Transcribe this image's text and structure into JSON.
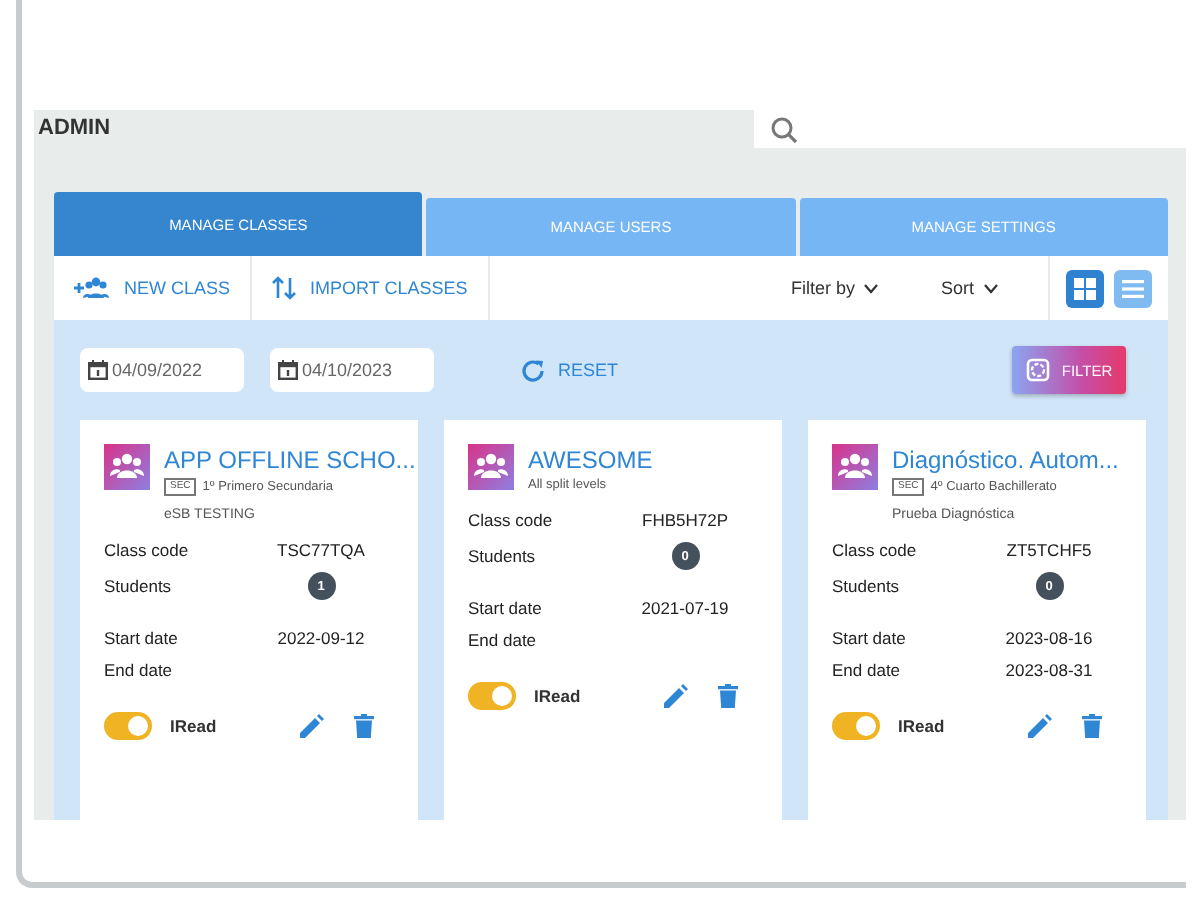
{
  "header": {
    "title": "ADMIN"
  },
  "tabs": [
    {
      "label": "MANAGE CLASSES",
      "selected": true
    },
    {
      "label": "MANAGE USERS",
      "selected": false
    },
    {
      "label": "MANAGE SETTINGS",
      "selected": false
    }
  ],
  "toolbar": {
    "actions": [
      {
        "kind": "new",
        "label": "NEW CLASS"
      },
      {
        "kind": "import",
        "label": "IMPORT CLASSES"
      }
    ],
    "filter_by": "Filter by",
    "sort": "Sort",
    "views": [
      {
        "kind": "grid",
        "selected": true
      },
      {
        "kind": "list",
        "selected": false
      }
    ]
  },
  "filters": {
    "start_date": "04/09/2022",
    "end_date": "04/10/2023",
    "reset": "RESET",
    "filter": "FILTER"
  },
  "classes": [
    {
      "title": "APP OFFLINE SCHO...",
      "badge": "SEC",
      "level": "1º Primero Secundaria",
      "org": "eSB TESTING",
      "class_code_label": "Class code",
      "class_code": "TSC77TQA",
      "students_label": "Students",
      "students": "1",
      "start_label": "Start date",
      "start": "2022-09-12",
      "end_label": "End date",
      "toggle_label": "IRead",
      "on": true
    },
    {
      "title": "AWESOME",
      "level": "All split levels",
      "class_code_label": "Class code",
      "class_code": "FHB5H72P",
      "students_label": "Students",
      "students": "0",
      "start_label": "Start date",
      "start": "2021-07-19",
      "end_label": "End date",
      "toggle_label": "IRead",
      "on": true
    },
    {
      "title": "Diagnóstico. Autom...",
      "badge": "SEC",
      "level": "4º Cuarto Bachillerato",
      "org": "Prueba Diagnóstica",
      "class_code_label": "Class code",
      "class_code": "ZT5TCHF5",
      "students_label": "Students",
      "students": "0",
      "start_label": "Start date",
      "start": "2023-08-16",
      "end_label": "End date",
      "end": "2023-08-31",
      "toggle_label": "IRead",
      "on": true
    }
  ]
}
